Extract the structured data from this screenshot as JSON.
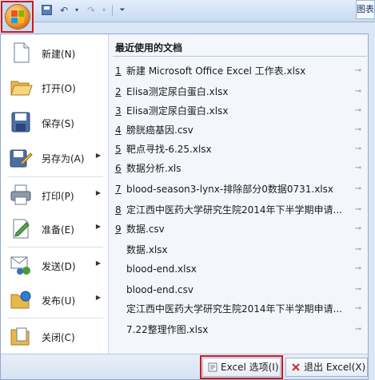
{
  "app": {
    "tab_right_label": "图表"
  },
  "quick_access": {
    "icons": [
      "save-icon",
      "undo-icon",
      "redo-icon",
      "customize-icon"
    ]
  },
  "commands": [
    {
      "label": "新建(N)",
      "icon": "new-document-icon",
      "has_submenu": false
    },
    {
      "label": "打开(O)",
      "icon": "open-folder-icon",
      "has_submenu": false
    },
    {
      "label": "保存(S)",
      "icon": "save-icon",
      "has_submenu": false
    },
    {
      "label": "另存为(A)",
      "icon": "save-as-icon",
      "has_submenu": true
    },
    {
      "label": "打印(P)",
      "icon": "print-icon",
      "has_submenu": true
    },
    {
      "label": "准备(E)",
      "icon": "prepare-icon",
      "has_submenu": true
    },
    {
      "label": "发送(D)",
      "icon": "send-icon",
      "has_submenu": true
    },
    {
      "label": "发布(U)",
      "icon": "publish-icon",
      "has_submenu": true
    },
    {
      "label": "关闭(C)",
      "icon": "close-document-icon",
      "has_submenu": false
    }
  ],
  "recent": {
    "title": "最近使用的文档",
    "items": [
      {
        "num": "1",
        "name": "新建 Microsoft Office Excel 工作表.xlsx"
      },
      {
        "num": "2",
        "name": "Elisa测定尿白蛋白.xlsx"
      },
      {
        "num": "3",
        "name": "Elisa测定尿白蛋白.xlsx"
      },
      {
        "num": "4",
        "name": "膀胱癌基因.csv"
      },
      {
        "num": "5",
        "name": "靶点寻找-6.25.xlsx"
      },
      {
        "num": "6",
        "name": "数据分析.xls"
      },
      {
        "num": "7",
        "name": "blood-season3-lynx-排除部分0数据0731.xlsx"
      },
      {
        "num": "8",
        "name": "定江西中医药大学研究生院2014年下半学期申请..."
      },
      {
        "num": "9",
        "name": "数据.csv"
      },
      {
        "num": "",
        "name": "数据.xlsx"
      },
      {
        "num": "",
        "name": "blood-end.xlsx"
      },
      {
        "num": "",
        "name": "blood-end.csv"
      },
      {
        "num": "",
        "name": "定江西中医药大学研究生院2014年下半学期申请..."
      },
      {
        "num": "",
        "name": "7.22整理作图.xlsx"
      }
    ]
  },
  "bottom": {
    "options_label": "Excel 选项(I)",
    "exit_label": "退出 Excel(X)"
  }
}
